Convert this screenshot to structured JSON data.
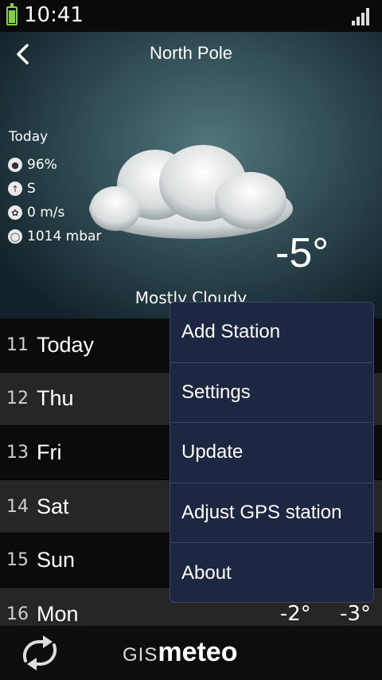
{
  "status": {
    "time": "10:41"
  },
  "header": {
    "city": "North Pole"
  },
  "current": {
    "label": "Today",
    "humidity": "96%",
    "wind_dir": "S",
    "wind_speed": "0 m/s",
    "pressure": "1014 mbar",
    "temperature": "-5°",
    "condition": "Mostly Cloudy"
  },
  "days": [
    {
      "num": "11",
      "name": "Today",
      "hi": "",
      "lo": ""
    },
    {
      "num": "12",
      "name": "Thu",
      "hi": "",
      "lo": ""
    },
    {
      "num": "13",
      "name": "Fri",
      "hi": "",
      "lo": ""
    },
    {
      "num": "14",
      "name": "Sat",
      "hi": "",
      "lo": ""
    },
    {
      "num": "15",
      "name": "Sun",
      "hi": "",
      "lo": ""
    },
    {
      "num": "16",
      "name": "Mon",
      "hi": "-2°",
      "lo": "-3°"
    }
  ],
  "menu": {
    "items": [
      "Add Station",
      "Settings",
      "Update",
      "Adjust GPS station",
      "About"
    ]
  },
  "brand": {
    "gis": "GIS",
    "meteo": "meteo"
  },
  "icons": {
    "back": "chevron-left-icon",
    "humidity": "droplet-icon",
    "wind_dir": "wind-direction-icon",
    "wind_speed": "fan-icon",
    "pressure": "gauge-icon",
    "refresh": "refresh-icon"
  },
  "colors": {
    "menu_bg": "#1e2742",
    "battery": "#7fd13a"
  }
}
